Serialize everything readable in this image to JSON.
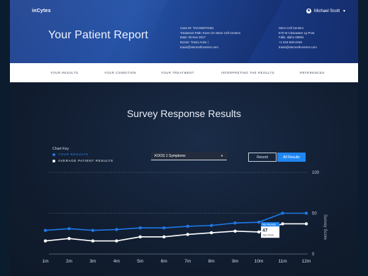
{
  "app": {
    "logo": "inCytes",
    "user_name": "Michael Scott"
  },
  "header": {
    "title": "Your Patient Report",
    "case_info": [
      "Case ID: TACSNDTA001",
      "Treatment Path: Knee OA Stem Cell Centers",
      "Date: 03 Nov 2017",
      "Doctor: Travis Aulor |",
      "travis@stemcellcenters.com"
    ],
    "clinic_info": [
      "Stem Cell Centers",
      "570 W Clearwater Lp Post",
      "Falls, Idaho 83854",
      "+1 844-633-4346",
      "travis@stemcellcenters.com"
    ]
  },
  "nav": {
    "items": [
      "YOUR RESULTS",
      "YOUR CONDITION",
      "YOUR TREATMENT",
      "INTERPRETING THE RESULTS",
      "REFERENCES"
    ]
  },
  "section": {
    "title": "Survey Response Results",
    "chart_key_title": "Chart Key",
    "select_value": "KOOS 1 Symptoms",
    "toggle": {
      "recent": "Recent",
      "all": "All Results"
    }
  },
  "colors": {
    "your_results": "#1e78e8",
    "average": "#ffffff",
    "accent": "#1f86f2",
    "header": "#2452a8"
  },
  "icons": {
    "user": "user-circle-icon",
    "dropdown": "chevron-down-icon"
  },
  "chart_data": {
    "type": "line",
    "x": [
      "1m",
      "2m",
      "3m",
      "4m",
      "5m",
      "6m",
      "7m",
      "8m",
      "9m",
      "10m",
      "11m",
      "12m"
    ],
    "series": [
      {
        "name": "YOUR RESULTS",
        "values": [
          29,
          31,
          29,
          30,
          32,
          32,
          34,
          35,
          38,
          39,
          50,
          50
        ]
      },
      {
        "name": "AVERAGE PATIENT RESULTS",
        "values": [
          16,
          19,
          16,
          16,
          21,
          21,
          24,
          26,
          28,
          27,
          37,
          37
        ]
      }
    ],
    "ylabel": "Survey Score",
    "ylim": [
      0,
      100
    ],
    "yticks": [
      0,
      50,
      100
    ],
    "tooltip": {
      "title": "My Results",
      "value": "47",
      "date": "Jan 2018"
    },
    "grid": true,
    "legend": "top-left"
  }
}
